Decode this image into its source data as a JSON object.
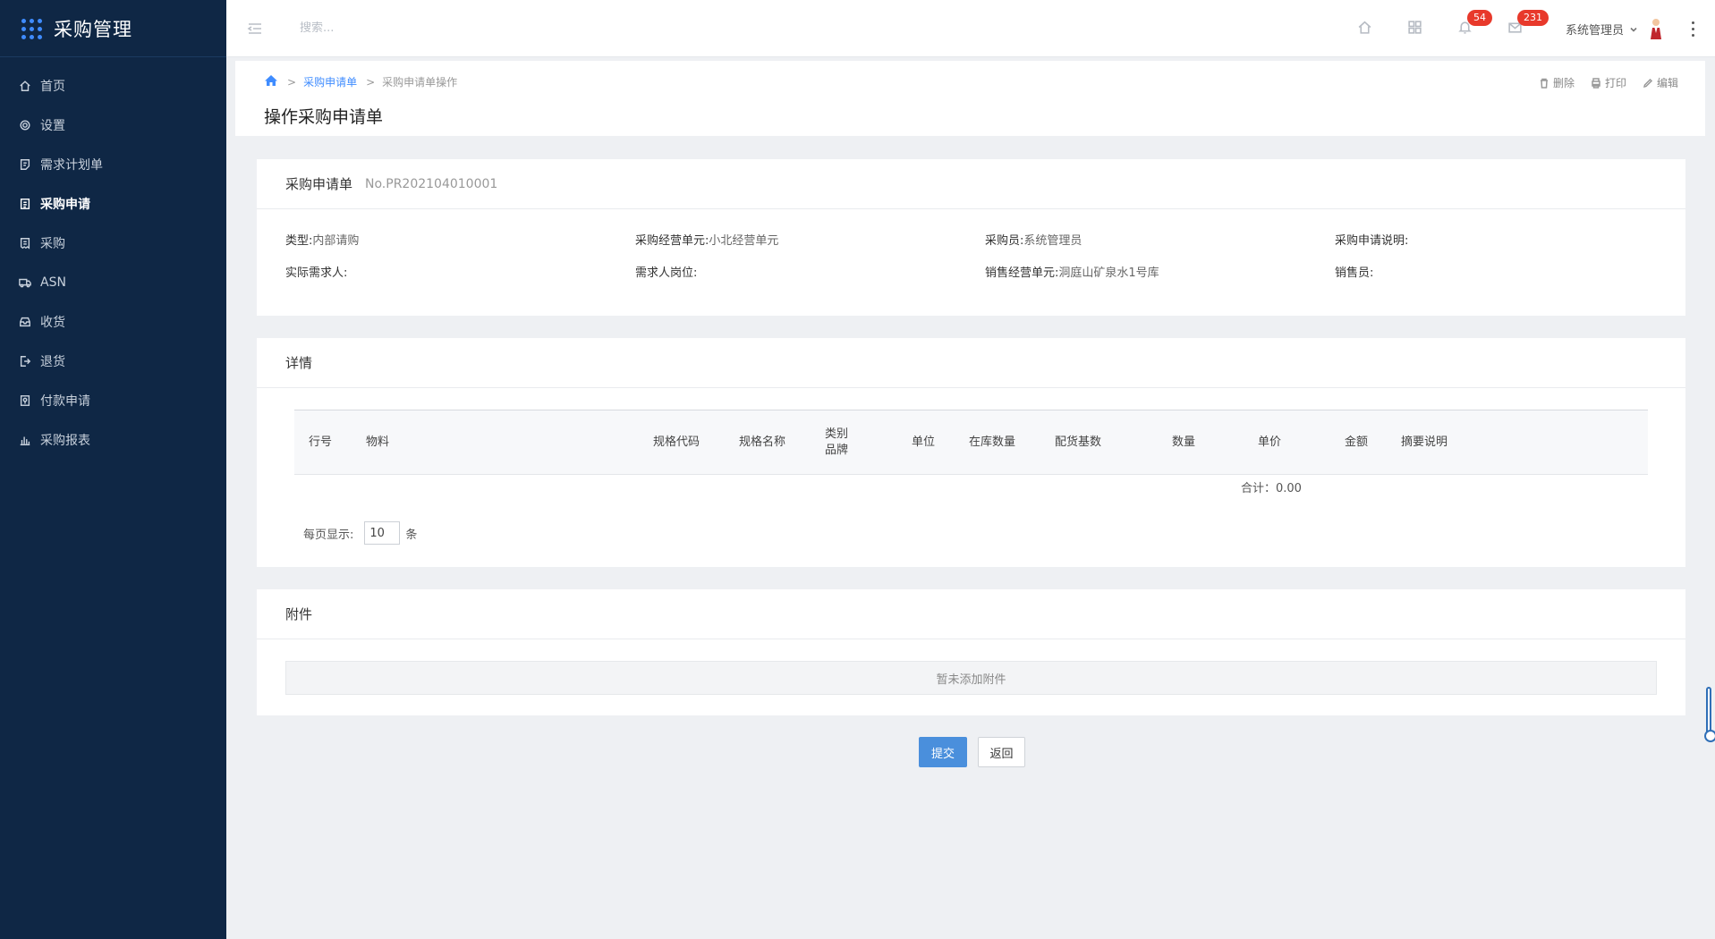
{
  "app": {
    "title": "采购管理"
  },
  "sidebar": {
    "items": [
      {
        "label": "首页",
        "icon": "home-icon"
      },
      {
        "label": "设置",
        "icon": "gear-icon"
      },
      {
        "label": "需求计划单",
        "icon": "document-icon"
      },
      {
        "label": "采购申请",
        "icon": "clipboard-icon",
        "active": true
      },
      {
        "label": "采购",
        "icon": "receipt-icon"
      },
      {
        "label": "ASN",
        "icon": "truck-icon"
      },
      {
        "label": "收货",
        "icon": "inbox-icon"
      },
      {
        "label": "退货",
        "icon": "exit-icon"
      },
      {
        "label": "付款申请",
        "icon": "payment-icon"
      },
      {
        "label": "采购报表",
        "icon": "bar-chart-icon"
      }
    ]
  },
  "topbar": {
    "search_placeholder": "搜索...",
    "notifications_count": "54",
    "messages_count": "231",
    "user_name": "系统管理员"
  },
  "breadcrumb": {
    "link": "采购申请单",
    "current": "采购申请单操作"
  },
  "page": {
    "title": "操作采购申请单",
    "actions": {
      "delete": "删除",
      "print": "打印",
      "edit": "编辑"
    }
  },
  "order": {
    "header": "采购申请单",
    "number": "No.PR202104010001",
    "fields": [
      {
        "label": "类型:",
        "value": "内部请购"
      },
      {
        "label": "采购经营单元:",
        "value": "小北经营单元"
      },
      {
        "label": "采购员:",
        "value": "系统管理员"
      },
      {
        "label": "采购申请说明:",
        "value": ""
      },
      {
        "label": "实际需求人:",
        "value": ""
      },
      {
        "label": "需求人岗位:",
        "value": ""
      },
      {
        "label": "销售经营单元:",
        "value": "洞庭山矿泉水1号库"
      },
      {
        "label": "销售员:",
        "value": ""
      }
    ]
  },
  "details": {
    "header": "详情",
    "columns": [
      "行号",
      "物料",
      "规格代码",
      "规格名称",
      "类别",
      "品牌",
      "单位",
      "在库数量",
      "配货基数",
      "数量",
      "单价",
      "金额",
      "摘要说明"
    ],
    "total": "合计：0.00",
    "page_size_label": "每页显示:",
    "page_size_value": "10",
    "page_size_unit": "条"
  },
  "attachments": {
    "header": "附件",
    "empty_text": "暂未添加附件"
  },
  "buttons": {
    "submit": "提交",
    "back": "返回"
  },
  "colors": {
    "sidebar_bg": "#0f2745",
    "accent": "#3f8cff",
    "primary_button": "#4a8fdc",
    "badge": "#e8392b"
  }
}
